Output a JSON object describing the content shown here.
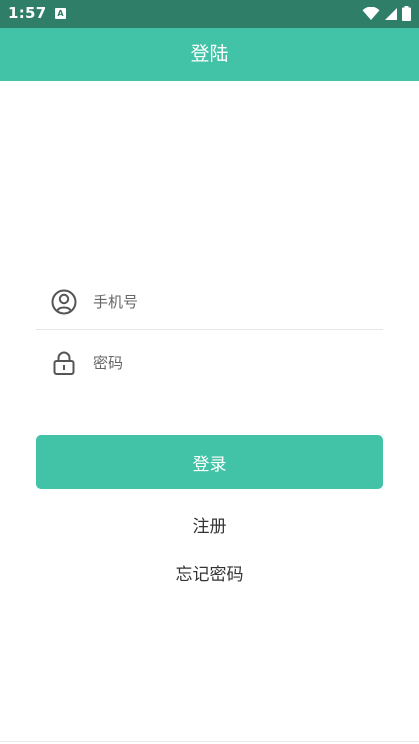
{
  "status_bar": {
    "time": "1:57",
    "notification_icon": "a-square-icon",
    "icons": [
      "wifi-icon",
      "signal-icon",
      "battery-icon"
    ],
    "background": "#2f7e68"
  },
  "app_bar": {
    "title": "登陆",
    "background": "#42c2a6"
  },
  "form": {
    "phone": {
      "icon": "user-circle-icon",
      "placeholder": "手机号",
      "value": ""
    },
    "password": {
      "icon": "lock-icon",
      "placeholder": "密码",
      "value": ""
    },
    "login_label": "登录",
    "register_label": "注册",
    "forgot_label": "忘记密码"
  },
  "colors": {
    "accent": "#42c2a6",
    "text": "#333333",
    "icon": "#555555"
  }
}
